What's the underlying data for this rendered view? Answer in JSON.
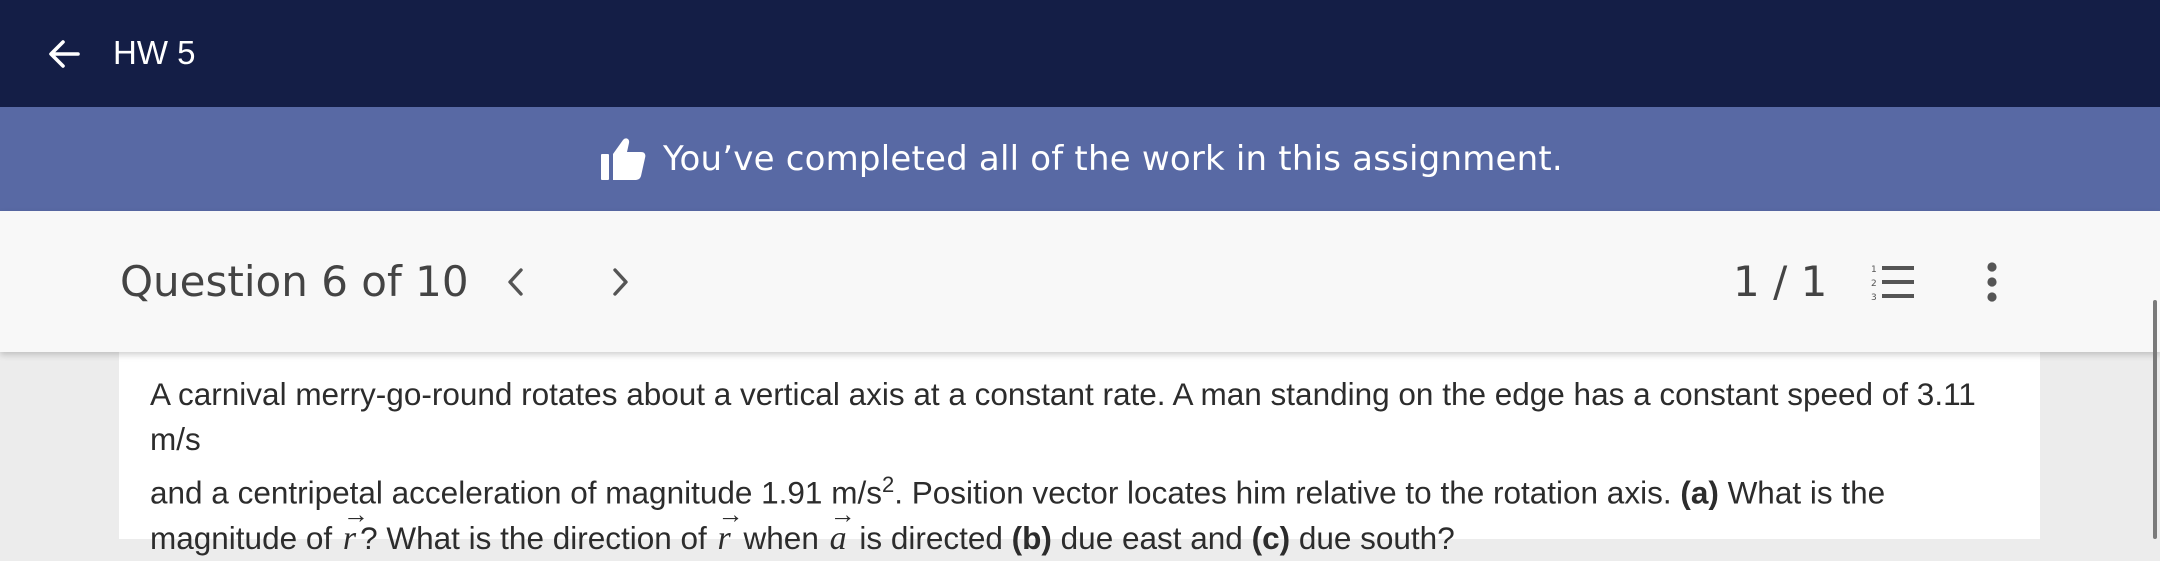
{
  "header": {
    "title": "HW 5"
  },
  "banner": {
    "message": "You’ve completed all of the work in this assignment."
  },
  "toolbar": {
    "question_label": "Question 6 of 10",
    "part_counter": "1 / 1"
  },
  "question": {
    "line1": "A carnival merry-go-round rotates about a vertical axis at a constant rate. A man standing on the edge has a constant speed of 3.11 m/s",
    "line2_a": "and a centripetal acceleration of magnitude 1.91 m/s",
    "line2_sup": "2",
    "line2_b": ". Position vector locates him relative to the rotation axis. ",
    "part_a_label": "(a)",
    "line2_c": " What is the",
    "line3_a": "magnitude of ",
    "vec_r": "r",
    "line3_b": "? What is the direction of ",
    "line3_c": " when ",
    "vec_a": "a",
    "line3_d": " is directed ",
    "part_b_label": "(b)",
    "line3_e": " due east and ",
    "part_c_label": "(c)",
    "line3_f": " due south?",
    "arrow_glyph": "⃗"
  },
  "icons": {
    "back": "arrow-left-icon",
    "banner": "thumbs-up-icon",
    "prev": "chevron-left-icon",
    "next": "chevron-right-icon",
    "list": "numbered-list-icon",
    "more": "more-vertical-icon"
  },
  "colors": {
    "header_bg": "#141e46",
    "banner_bg": "#5869a4",
    "toolbar_bg": "#f8f8f8"
  }
}
